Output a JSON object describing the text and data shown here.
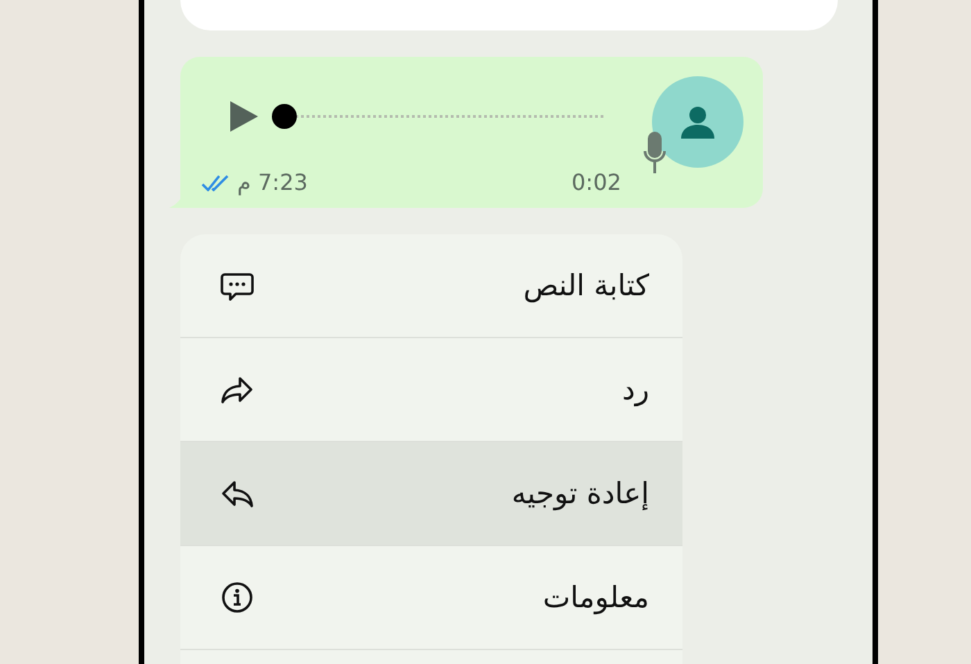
{
  "voice_message": {
    "level": 0,
    "duration": "0:02",
    "time": "7:23 م",
    "read": true
  },
  "context_menu": {
    "items": [
      {
        "label": "كتابة النص",
        "kind": "transcribe",
        "selected": false
      },
      {
        "label": "رد",
        "kind": "reply",
        "selected": false
      },
      {
        "label": "إعادة توجيه",
        "kind": "forward",
        "selected": true
      },
      {
        "label": "معلومات",
        "kind": "info",
        "selected": false
      }
    ]
  }
}
